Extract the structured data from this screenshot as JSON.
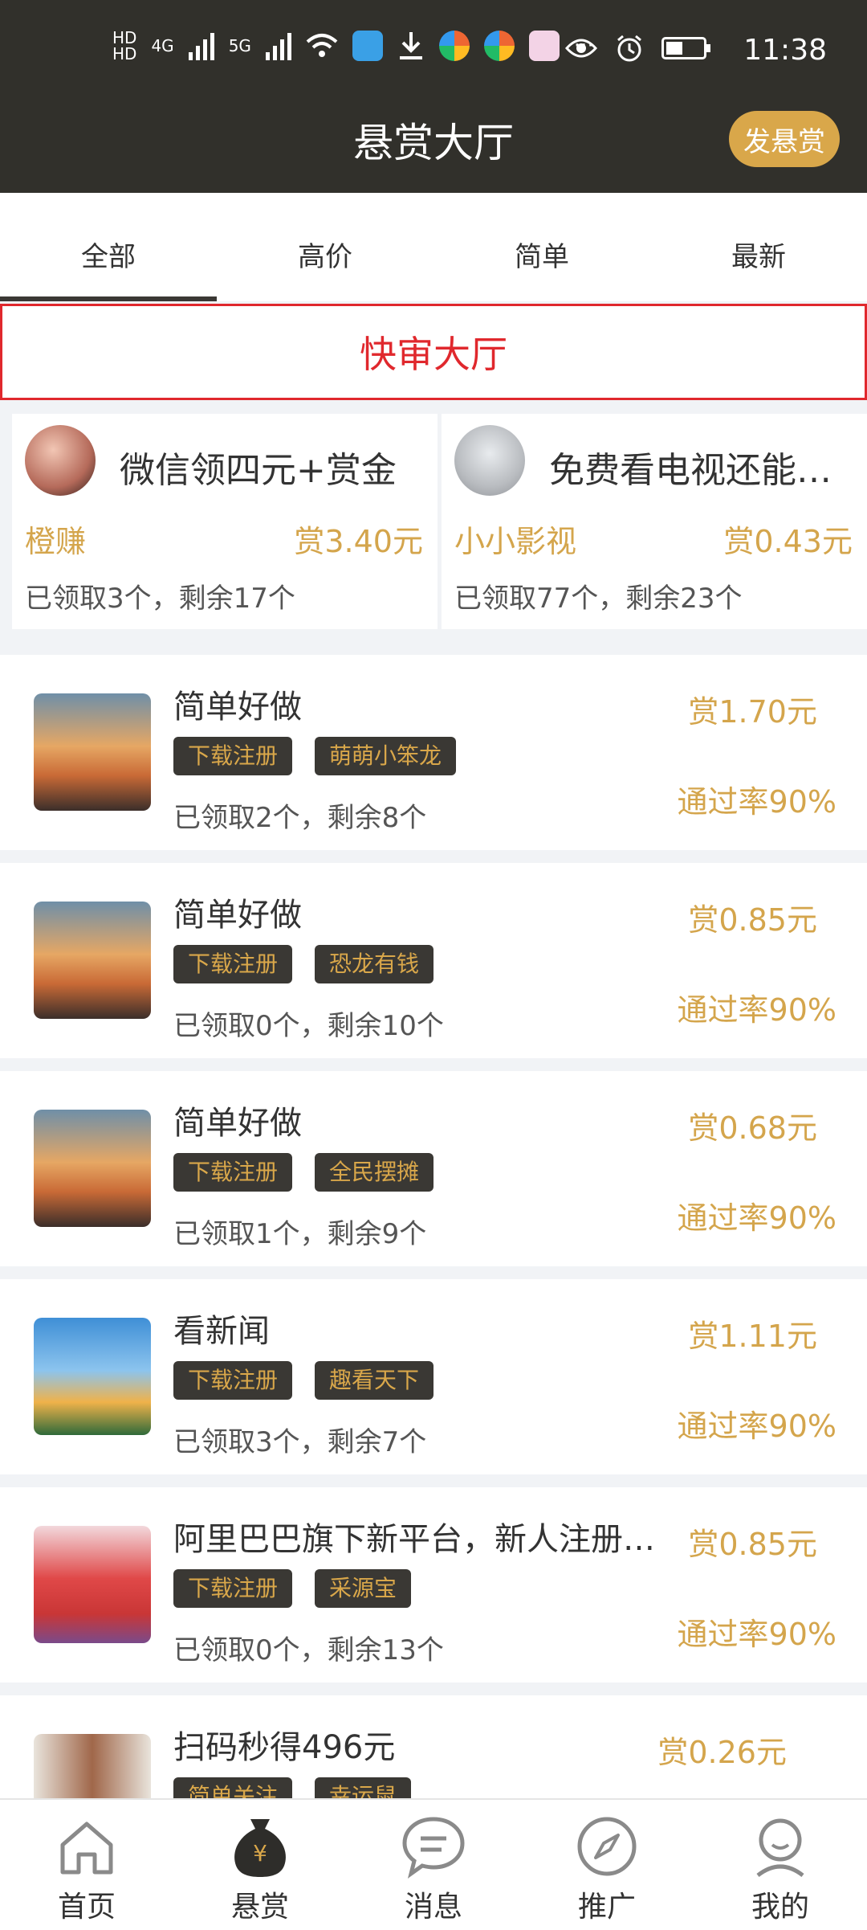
{
  "status_bar": {
    "time": "11:38",
    "network_left": "4G",
    "network_right": "5G",
    "more": "···"
  },
  "header": {
    "title": "悬赏大厅",
    "post_button": "发悬赏"
  },
  "tabs": [
    {
      "label": "全部",
      "active": true
    },
    {
      "label": "高价",
      "active": false
    },
    {
      "label": "简单",
      "active": false
    },
    {
      "label": "最新",
      "active": false
    }
  ],
  "quick_hall": {
    "label": "快审大厅"
  },
  "featured": [
    {
      "title": "微信领四元+赏金",
      "name": "橙赚",
      "reward": "赏3.40元",
      "stats": "已领取3个，剩余17个"
    },
    {
      "title": "免费看电视还能…",
      "name": "小小影视",
      "reward": "赏0.43元",
      "stats": "已领取77个，剩余23个"
    }
  ],
  "tasks": [
    {
      "title": "简单好做",
      "tags": [
        "下载注册",
        "萌萌小笨龙"
      ],
      "stats": "已领取2个，剩余8个",
      "reward": "赏1.70元",
      "pass_rate": "通过率90%"
    },
    {
      "title": "简单好做",
      "tags": [
        "下载注册",
        "恐龙有钱"
      ],
      "stats": "已领取0个，剩余10个",
      "reward": "赏0.85元",
      "pass_rate": "通过率90%"
    },
    {
      "title": "简单好做",
      "tags": [
        "下载注册",
        "全民摆摊"
      ],
      "stats": "已领取1个，剩余9个",
      "reward": "赏0.68元",
      "pass_rate": "通过率90%"
    },
    {
      "title": "看新闻",
      "tags": [
        "下载注册",
        "趣看天下"
      ],
      "stats": "已领取3个，剩余7个",
      "reward": "赏1.11元",
      "pass_rate": "通过率90%"
    },
    {
      "title": "阿里巴巴旗下新平台，新人注册…",
      "tags": [
        "下载注册",
        "采源宝"
      ],
      "stats": "已领取0个，剩余13个",
      "reward": "赏0.85元",
      "pass_rate": "通过率90%"
    },
    {
      "title": "扫码秒得496元",
      "tags": [
        "简单关注",
        "幸运鼠"
      ],
      "stats": "",
      "reward": "赏0.26元",
      "pass_rate": ""
    }
  ],
  "bottom_nav": [
    {
      "label": "首页",
      "icon": "home-icon"
    },
    {
      "label": "悬赏",
      "icon": "money-bag-icon"
    },
    {
      "label": "消息",
      "icon": "message-icon"
    },
    {
      "label": "推广",
      "icon": "compass-icon"
    },
    {
      "label": "我的",
      "icon": "profile-icon"
    }
  ],
  "colors": {
    "header_bg": "#31302b",
    "accent_gold": "#d9a74a",
    "reward_text": "#d4a54c",
    "quick_hall_red": "#e0282d",
    "tag_bg": "#3a3834"
  }
}
